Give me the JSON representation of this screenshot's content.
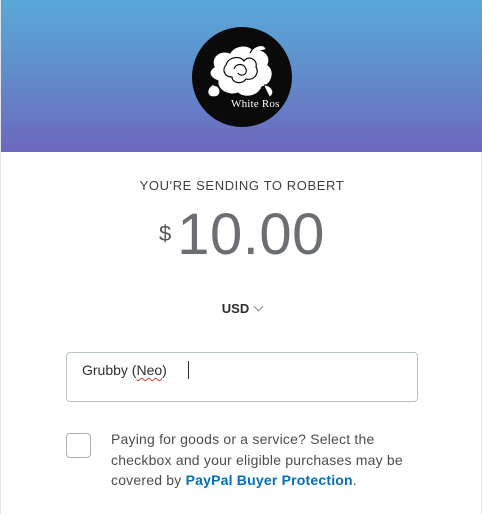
{
  "recipient": {
    "heading": "YOU'RE SENDING TO ROBERT",
    "avatar_caption": "White Ros"
  },
  "amount": {
    "symbol": "$",
    "value": "10.00"
  },
  "currency": {
    "selected": "USD"
  },
  "note": {
    "part1": "Grubby (",
    "misspelled": "Neo",
    "part2": ")"
  },
  "protection": {
    "text": "Paying for goods or a service? Select the checkbox and your eligible purchases may be covered by ",
    "link": "PayPal Buyer Protection",
    "end": "."
  },
  "colors": {
    "header_top": "#5aa9d8",
    "header_bottom": "#6d67bf",
    "link": "#0070ba"
  }
}
